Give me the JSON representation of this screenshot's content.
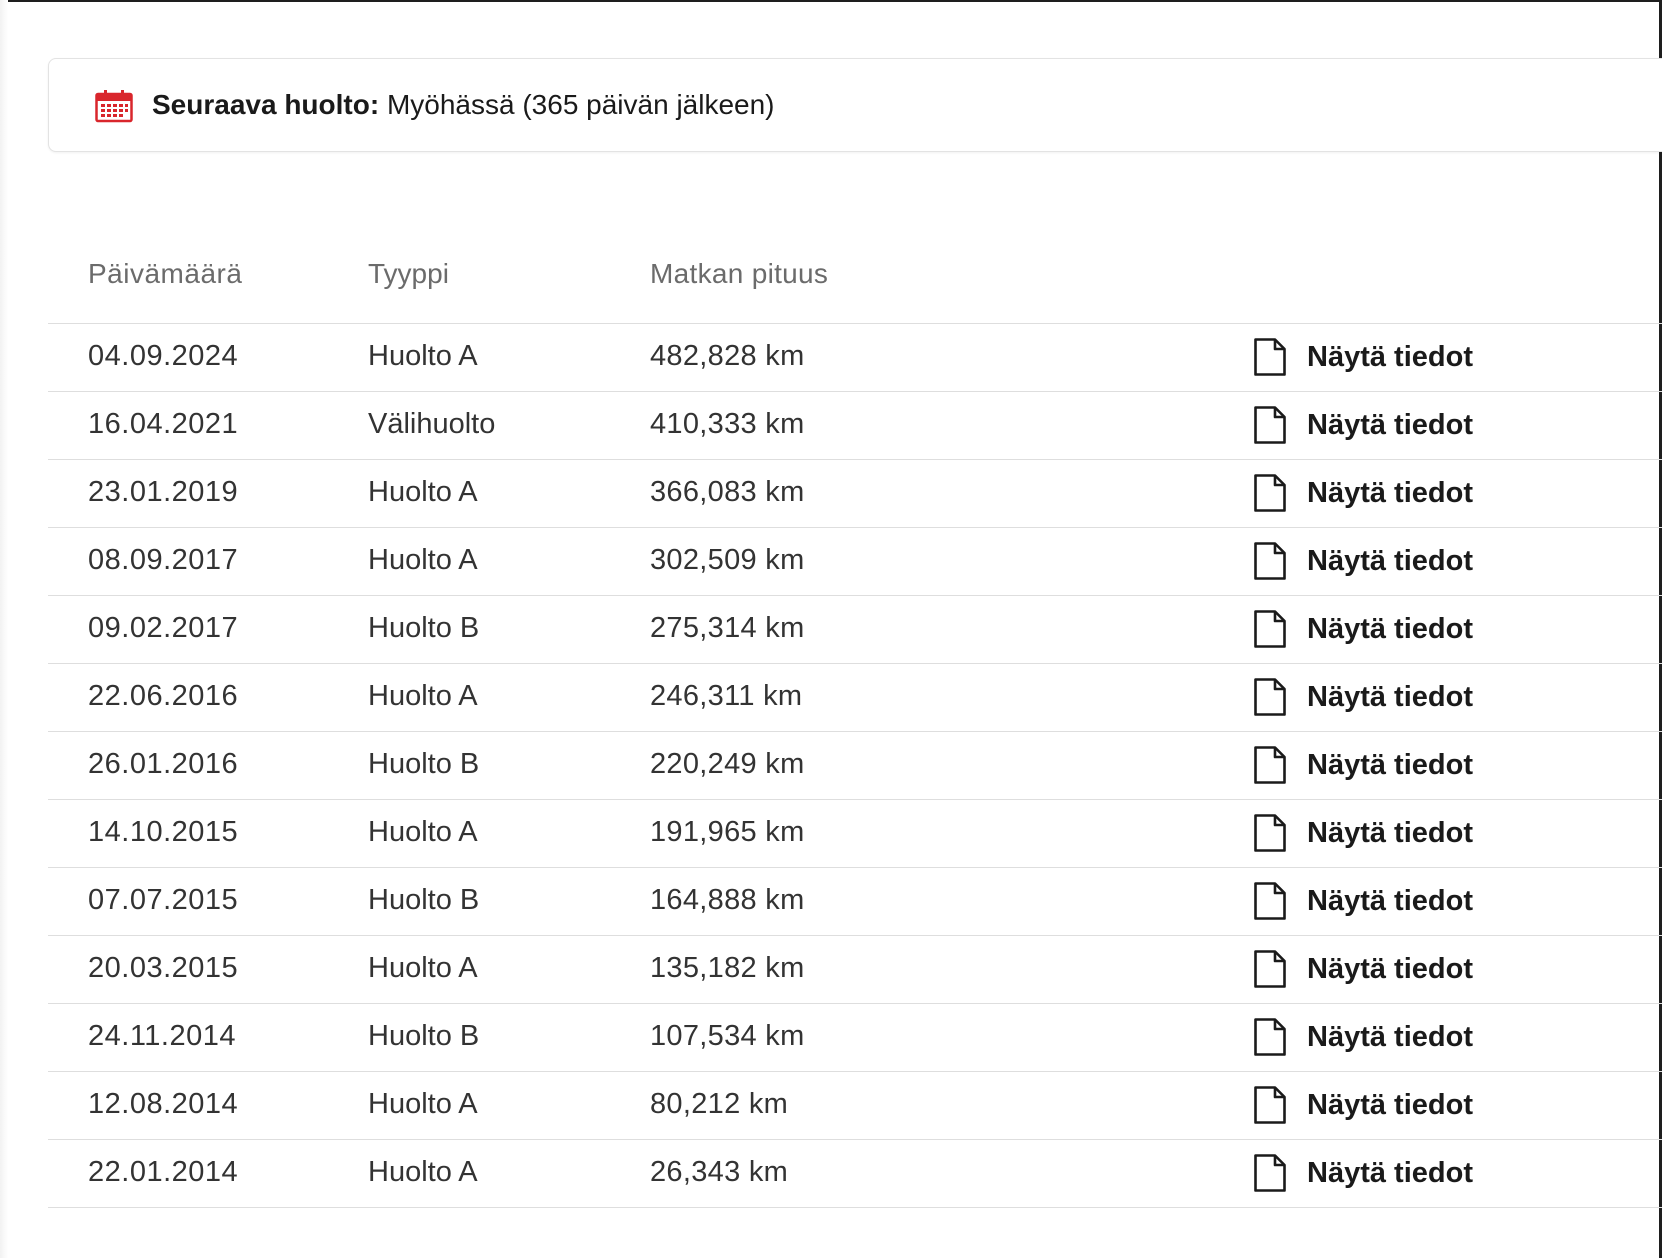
{
  "next_service": {
    "label": "Seuraava huolto:",
    "value": "Myöhässä (365 päivän jälkeen)",
    "icon": "calendar-icon",
    "icon_color": "#d9262c"
  },
  "table": {
    "columns": [
      "Päivämäärä",
      "Tyyppi",
      "Matkan pituus"
    ],
    "action_label": "Näytä tiedot",
    "action_icon": "document-icon",
    "rows": [
      {
        "date": "04.09.2024",
        "type": "Huolto A",
        "distance": "482,828 km"
      },
      {
        "date": "16.04.2021",
        "type": "Välihuolto",
        "distance": "410,333 km"
      },
      {
        "date": "23.01.2019",
        "type": "Huolto A",
        "distance": "366,083 km"
      },
      {
        "date": "08.09.2017",
        "type": "Huolto A",
        "distance": "302,509 km"
      },
      {
        "date": "09.02.2017",
        "type": "Huolto B",
        "distance": "275,314 km"
      },
      {
        "date": "22.06.2016",
        "type": "Huolto A",
        "distance": "246,311 km"
      },
      {
        "date": "26.01.2016",
        "type": "Huolto B",
        "distance": "220,249 km"
      },
      {
        "date": "14.10.2015",
        "type": "Huolto A",
        "distance": "191,965 km"
      },
      {
        "date": "07.07.2015",
        "type": "Huolto B",
        "distance": "164,888 km"
      },
      {
        "date": "20.03.2015",
        "type": "Huolto A",
        "distance": "135,182 km"
      },
      {
        "date": "24.11.2014",
        "type": "Huolto B",
        "distance": "107,534 km"
      },
      {
        "date": "12.08.2014",
        "type": "Huolto A",
        "distance": "80,212 km"
      },
      {
        "date": "22.01.2014",
        "type": "Huolto A",
        "distance": "26,343 km"
      }
    ]
  }
}
